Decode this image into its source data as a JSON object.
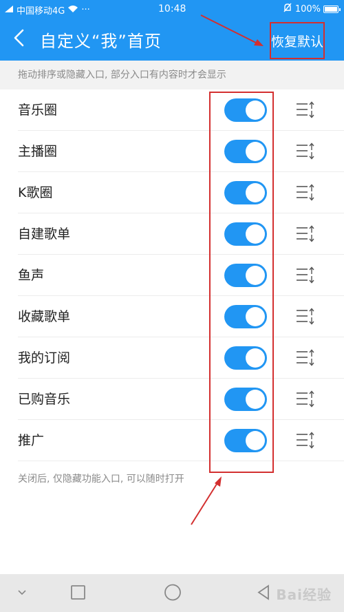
{
  "status_bar": {
    "carrier": "中国移动4G",
    "dots": "···",
    "time": "10:48",
    "battery": "100%"
  },
  "header": {
    "title": "自定义“我”首页",
    "restore_label": "恢复默认"
  },
  "hint": "拖动排序或隐藏入口, 部分入口有内容时才会显示",
  "items": [
    {
      "label": "音乐圈",
      "enabled": true
    },
    {
      "label": "主播圈",
      "enabled": true
    },
    {
      "label": "K歌圈",
      "enabled": true
    },
    {
      "label": "自建歌单",
      "enabled": true
    },
    {
      "label": "鱼声",
      "enabled": true
    },
    {
      "label": "收藏歌单",
      "enabled": true
    },
    {
      "label": "我的订阅",
      "enabled": true
    },
    {
      "label": "已购音乐",
      "enabled": true
    },
    {
      "label": "推广",
      "enabled": true
    }
  ],
  "footer_note": "关闭后, 仅隐藏功能入口, 可以随时打开",
  "watermark": "Bai经验",
  "colors": {
    "accent": "#2196f3",
    "annotation": "#d32f2f"
  },
  "icons": {
    "back": "chevron-left-icon",
    "drag": "drag-sort-icon",
    "nav": [
      "chevron-down-icon",
      "square-icon",
      "circle-icon",
      "back-triangle-icon"
    ]
  }
}
